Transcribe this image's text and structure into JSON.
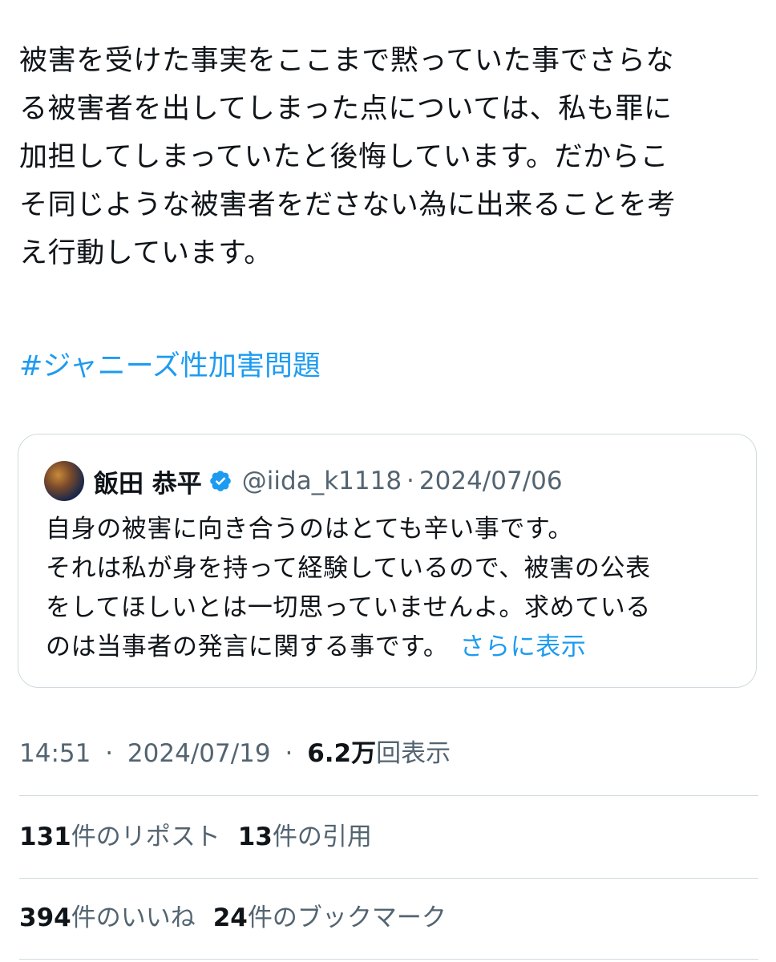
{
  "tweet": {
    "text_lines": [
      "被害を受けた事実をここまで黙っていた事でさらな",
      "る被害者を出してしまった点については、私も罪に",
      "加担してしまっていたと後悔しています。だからこ",
      "そ同じような被害者をださない為に出来ることを考",
      "え行動しています。"
    ],
    "hashtag": "#ジャニーズ性加害問題"
  },
  "quote": {
    "author_name": "飯田 恭平",
    "verified_icon": "verified-badge-icon",
    "handle": "@iida_k1118",
    "separator": "·",
    "date": "2024/07/06",
    "text_lines": [
      "自身の被害に向き合うのはとても辛い事です。",
      "それは私が身を持って経験しているので、被害の公表",
      "をしてほしいとは一切思っていませんよ。求めている",
      "のは当事者の発言に関する事です。"
    ],
    "show_more": "さらに表示"
  },
  "meta": {
    "time": "14:51",
    "sep1": "·",
    "date": "2024/07/19",
    "sep2": "·",
    "views_count": "6.2万",
    "views_label": "回表示"
  },
  "stats": {
    "reposts_count": "131",
    "reposts_label": "件のリポスト",
    "quotes_count": "13",
    "quotes_label": "件の引用",
    "likes_count": "394",
    "likes_label": "件のいいね",
    "bookmarks_count": "24",
    "bookmarks_label": "件のブックマーク"
  },
  "colors": {
    "link": "#1d9bf0",
    "text": "#0f1419",
    "secondary": "#536471",
    "border": "#cfd9de"
  }
}
